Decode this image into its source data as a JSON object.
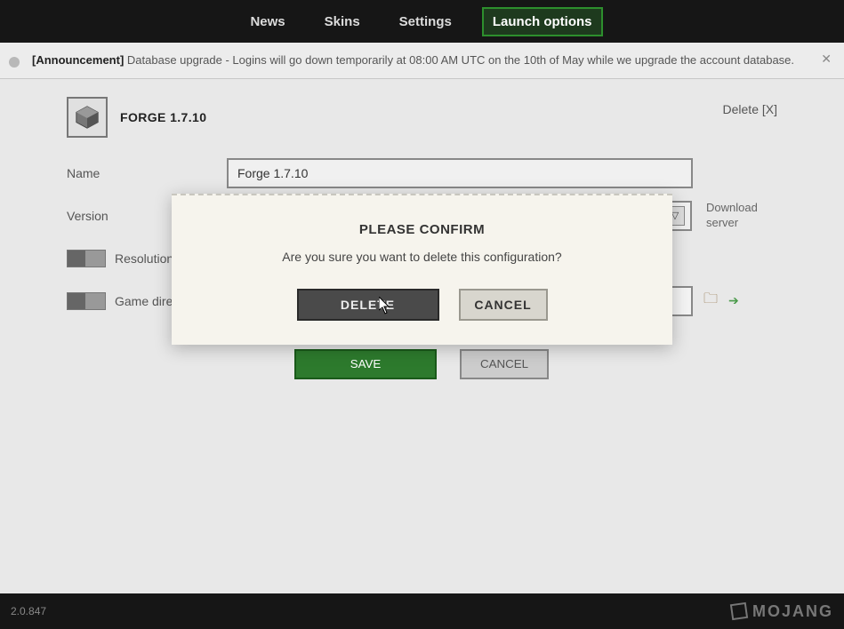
{
  "nav": {
    "tabs": [
      "News",
      "Skins",
      "Settings",
      "Launch options"
    ],
    "active": 3
  },
  "announcement": {
    "label": "[Announcement]",
    "text": "Database upgrade - Logins will go down temporarily at 08:00 AM UTC on the 10th of May while we upgrade the account database."
  },
  "profile": {
    "title": "FORGE 1.7.10",
    "delete_link": "Delete [X]"
  },
  "form": {
    "name_label": "Name",
    "name_value": "Forge 1.7.10",
    "version_label": "Version",
    "download_server": "Download server",
    "resolution_label": "Resolution",
    "gamedir_label": "Game direc",
    "save_label": "SAVE",
    "cancel_label": "CANCEL"
  },
  "modal": {
    "title": "PLEASE CONFIRM",
    "text": "Are you sure you want to delete this configuration?",
    "delete_label": "DELETE",
    "cancel_label": "CANCEL"
  },
  "footer": {
    "version": "2.0.847",
    "brand": "MOJANG"
  }
}
